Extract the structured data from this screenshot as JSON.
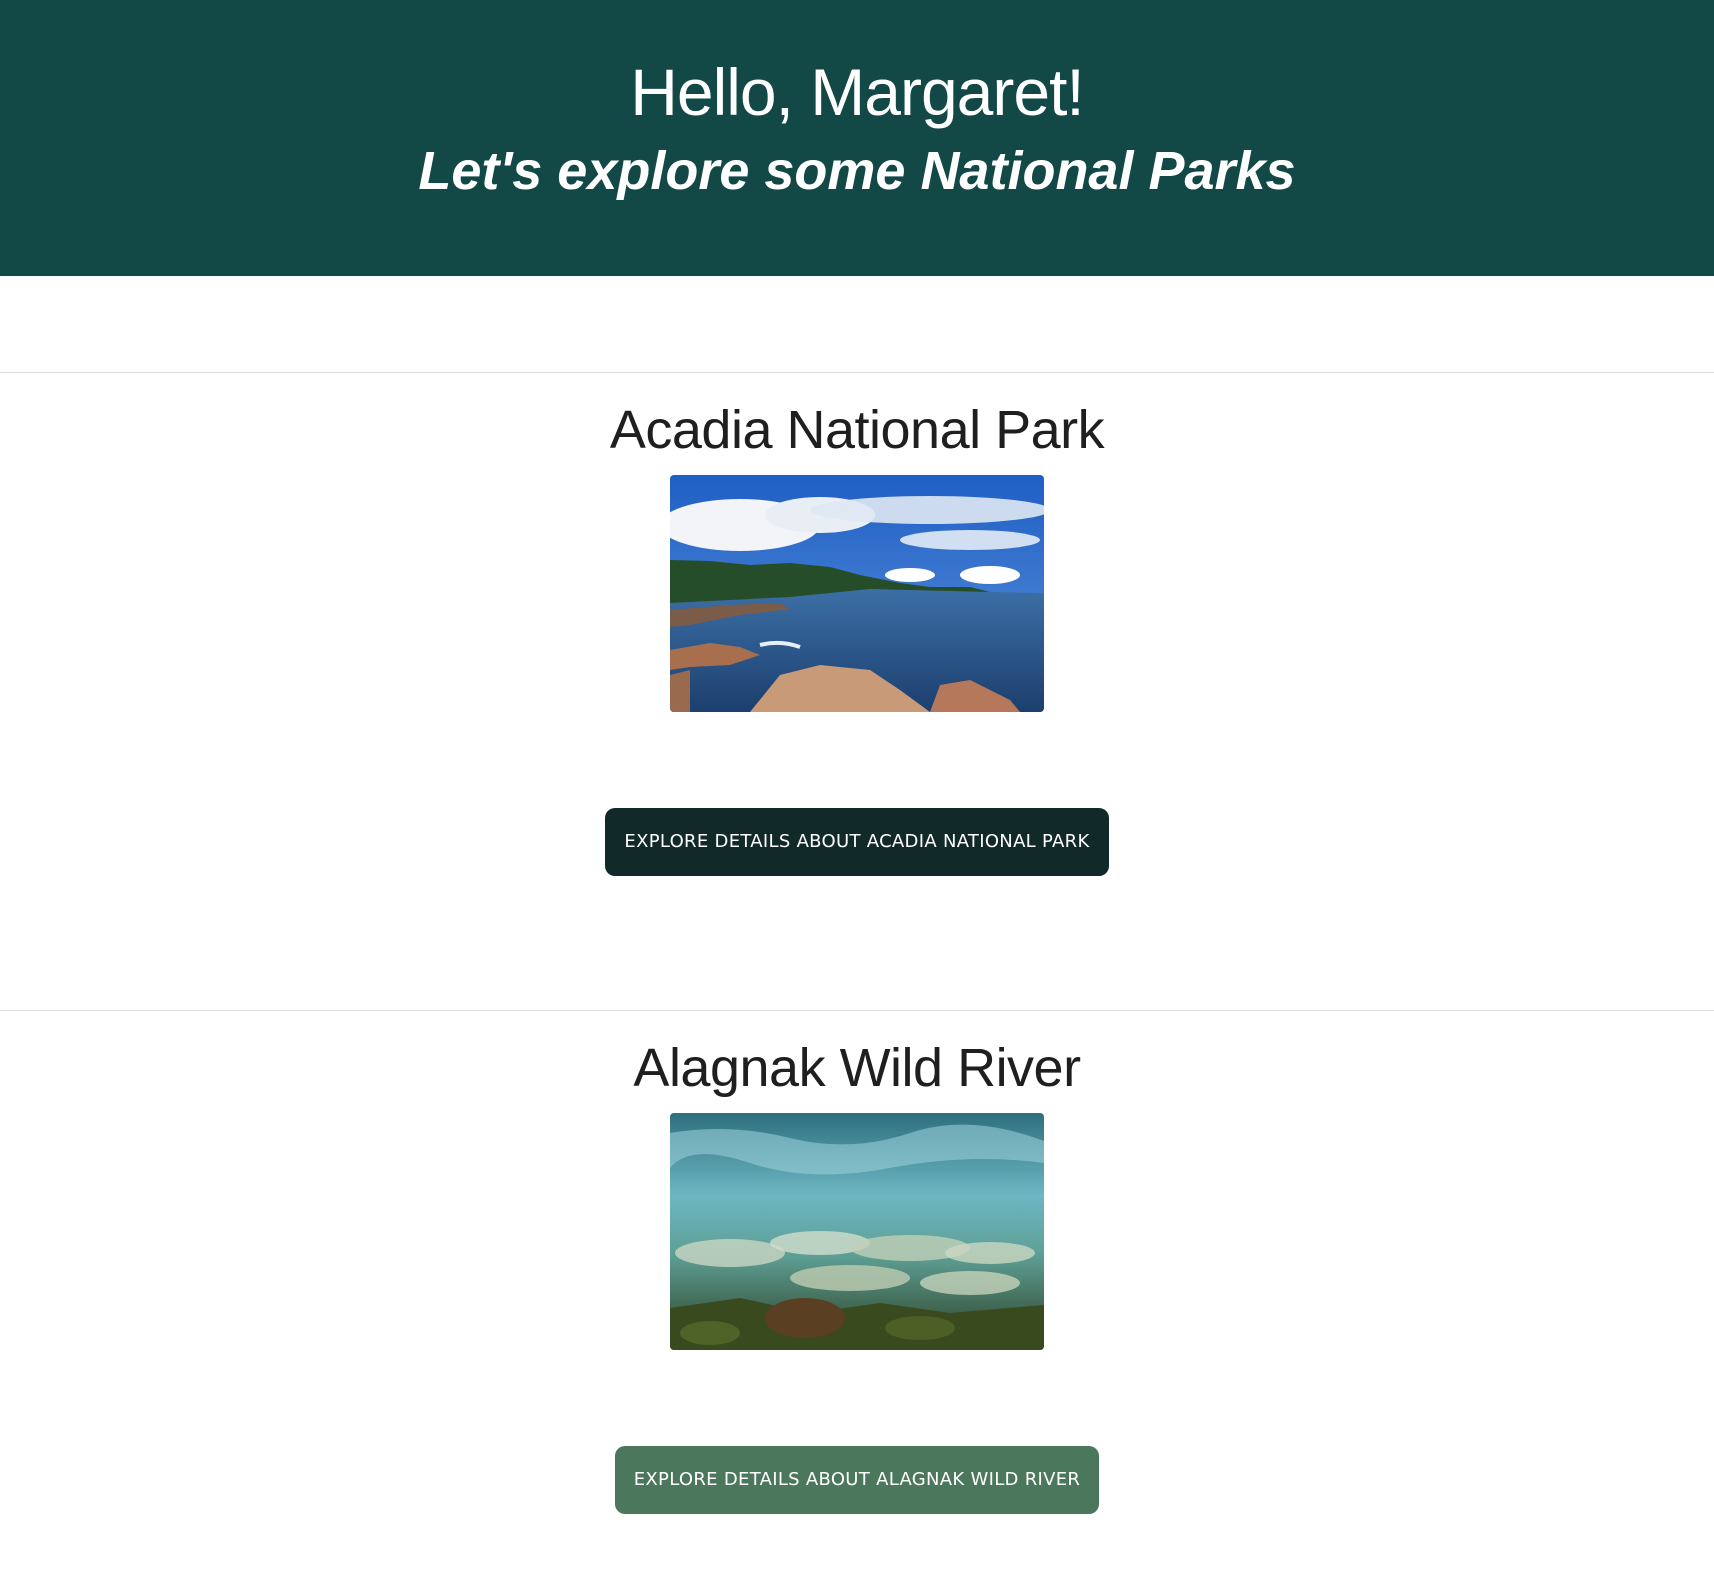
{
  "header": {
    "greeting": "Hello, Margaret!",
    "subtitle": "Let's explore some National Parks"
  },
  "parks": [
    {
      "name": "Acadia National Park",
      "image_description_icon": "coastline-photo",
      "button_label": "EXPLORE DETAILS ABOUT ACADIA NATIONAL PARK",
      "button_color": "#112a29"
    },
    {
      "name": "Alagnak Wild River",
      "image_description_icon": "underwater-salmon-photo",
      "button_label": "EXPLORE DETAILS ABOUT ALAGNAK WILD RIVER",
      "button_color": "#4b775c"
    }
  ],
  "colors": {
    "header_bg": "#124846",
    "divider": "#dcdcdc"
  }
}
